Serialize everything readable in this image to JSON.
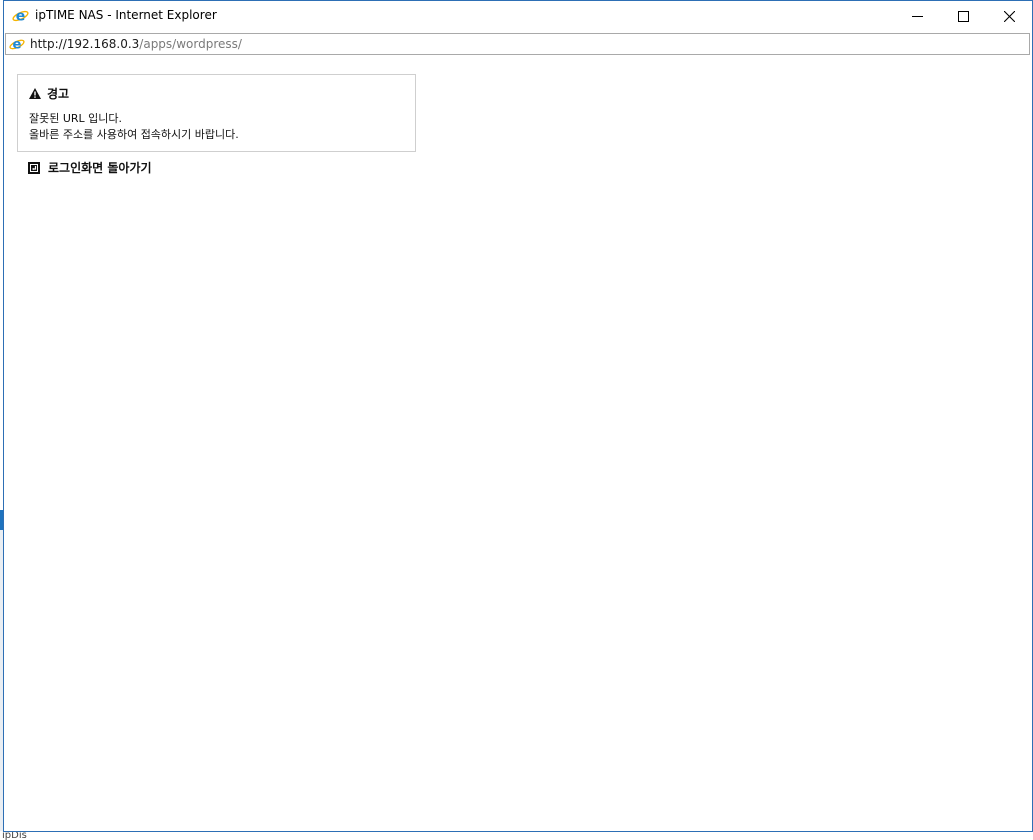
{
  "window": {
    "title": "ipTIME NAS - Internet Explorer"
  },
  "address": {
    "host": "http://192.168.0.3",
    "path": "/apps/wordpress/"
  },
  "alert": {
    "heading": "경고",
    "line1": "잘못된 URL 입니다.",
    "line2": "올바른 주소를 사용하여 접속하시기 바랍니다."
  },
  "back_link": {
    "label": "로그인화면 돌아가기"
  },
  "background": {
    "fragment": "ipDis"
  },
  "colors": {
    "window_border": "#2d6fb5",
    "ie_blue": "#1e8ad6",
    "ie_ring": "#f5b400"
  },
  "icons": {
    "app": "internet-explorer-icon",
    "minimize": "minimize-icon",
    "maximize": "maximize-icon",
    "close": "close-icon",
    "warning": "warning-triangle-icon",
    "back": "return-arrow-icon"
  }
}
